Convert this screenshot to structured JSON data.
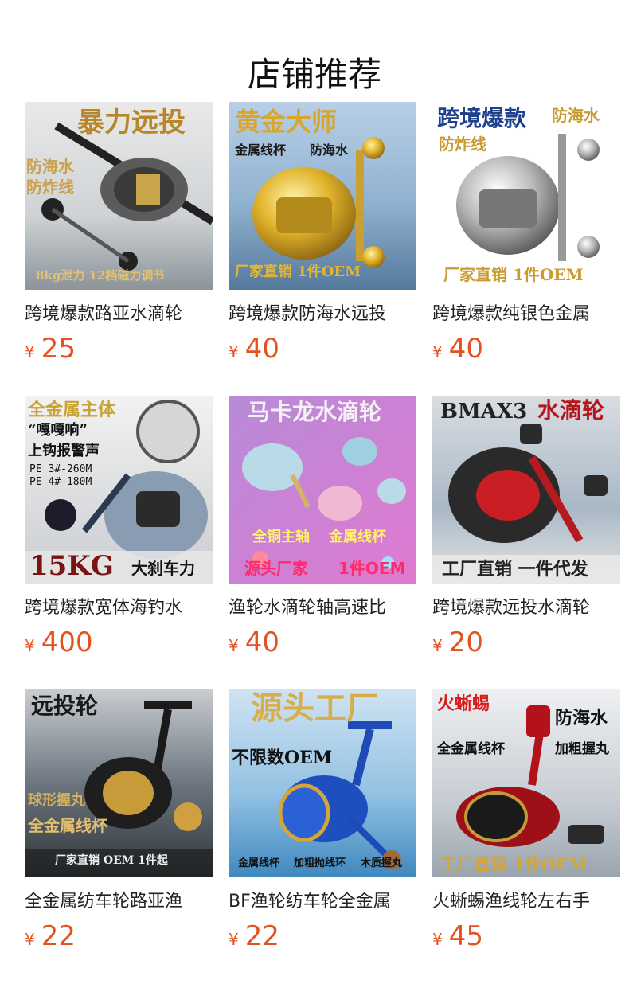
{
  "page": {
    "title": "店铺推荐"
  },
  "colors": {
    "price": "#e4521f",
    "title": "#111111"
  },
  "currency_symbol": "¥",
  "products": [
    {
      "name": "跨境爆款路亚水滴轮",
      "price": "25",
      "image_texts": [
        "暴力远投",
        "防海水",
        "防炸线",
        "8kg泄力 12档磁力调节"
      ],
      "icon": "baitcasting-reel-gray-icon"
    },
    {
      "name": "跨境爆款防海水远投",
      "price": "40",
      "image_texts": [
        "黄金大师",
        "金属线杯",
        "防海水",
        "厂家直销 1件OEM"
      ],
      "icon": "baitcasting-reel-gold-icon"
    },
    {
      "name": "跨境爆款纯银色金属",
      "price": "40",
      "image_texts": [
        "跨境爆款",
        "防海水",
        "防炸线",
        "厂家直销 1件OEM"
      ],
      "icon": "baitcasting-reel-silver-icon"
    },
    {
      "name": "跨境爆款宽体海钓水",
      "price": "400",
      "image_texts": [
        "全金属主体",
        "“嘎嘎响”",
        "上钩报警声",
        "PE 3#-260M",
        "PE 4#-180M",
        "15KG",
        "大刹车力"
      ],
      "icon": "baitcasting-reel-blue-icon"
    },
    {
      "name": "渔轮水滴轮轴高速比",
      "price": "40",
      "image_texts": [
        "马卡龙水滴轮",
        "全铜主轴",
        "金属线杯",
        "源头厂家",
        "1件OEM"
      ],
      "icon": "baitcasting-reel-pastel-icon"
    },
    {
      "name": "跨境爆款远投水滴轮",
      "price": "20",
      "image_texts": [
        "BMAX3",
        "水滴轮",
        "工厂直销 一件代发"
      ],
      "icon": "baitcasting-reel-red-icon"
    },
    {
      "name": "全金属纺车轮路亚渔",
      "price": "22",
      "image_texts": [
        "远投轮",
        "球形握丸",
        "全金属线杯",
        "厂家直销 OEM 1件起"
      ],
      "icon": "spinning-reel-black-icon"
    },
    {
      "name": "BF渔轮纺车轮全金属",
      "price": "22",
      "image_texts": [
        "源头工厂",
        "不限数OEM",
        "金属线杯",
        "加粗抛线环",
        "木质握丸"
      ],
      "icon": "spinning-reel-blue-icon"
    },
    {
      "name": "火蜥蜴渔线轮左右手",
      "price": "45",
      "image_texts": [
        "火蜥蜴",
        "防海水",
        "全金属线杯",
        "加粗握丸",
        "工厂直销 1件OEM"
      ],
      "icon": "spinning-reel-red-icon"
    }
  ]
}
